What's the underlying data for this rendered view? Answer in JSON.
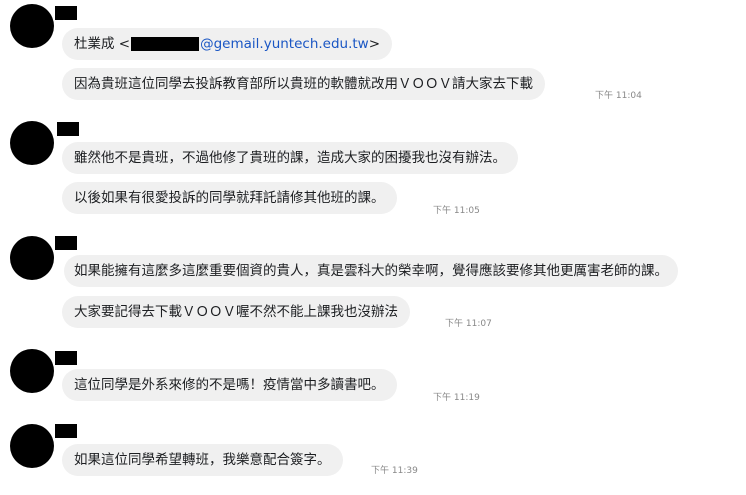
{
  "messages": [
    {
      "name_prefix": "杜業成 <",
      "email_domain": "@gemail.yuntech.edu.tw",
      "name_suffix": ">",
      "text": "因為貴班這位同學去投訴教育部所以貴班的軟體就改用ＶＯＯＶ請大家去下載",
      "time": "下午 11:04"
    },
    {
      "text": "雖然他不是貴班，不過他修了貴班的課，造成大家的困擾我也沒有辦法。"
    },
    {
      "text": "以後如果有很愛投訴的同學就拜託請修其他班的課。",
      "time": "下午 11:05"
    },
    {
      "text": "如果能擁有這麼多這麼重要個資的貴人，真是雲科大的榮幸啊，覺得應該要修其他更厲害老師的課。"
    },
    {
      "text": "大家要記得去下載ＶＯＯＶ喔不然不能上課我也沒辦法",
      "time": "下午 11:07"
    },
    {
      "text": "這位同學是外系來修的不是嗎！疫情當中多讀書吧。",
      "time": "下午 11:19"
    },
    {
      "text": "如果這位同學希望轉班，我樂意配合簽字。",
      "time": "下午 11:39"
    }
  ]
}
